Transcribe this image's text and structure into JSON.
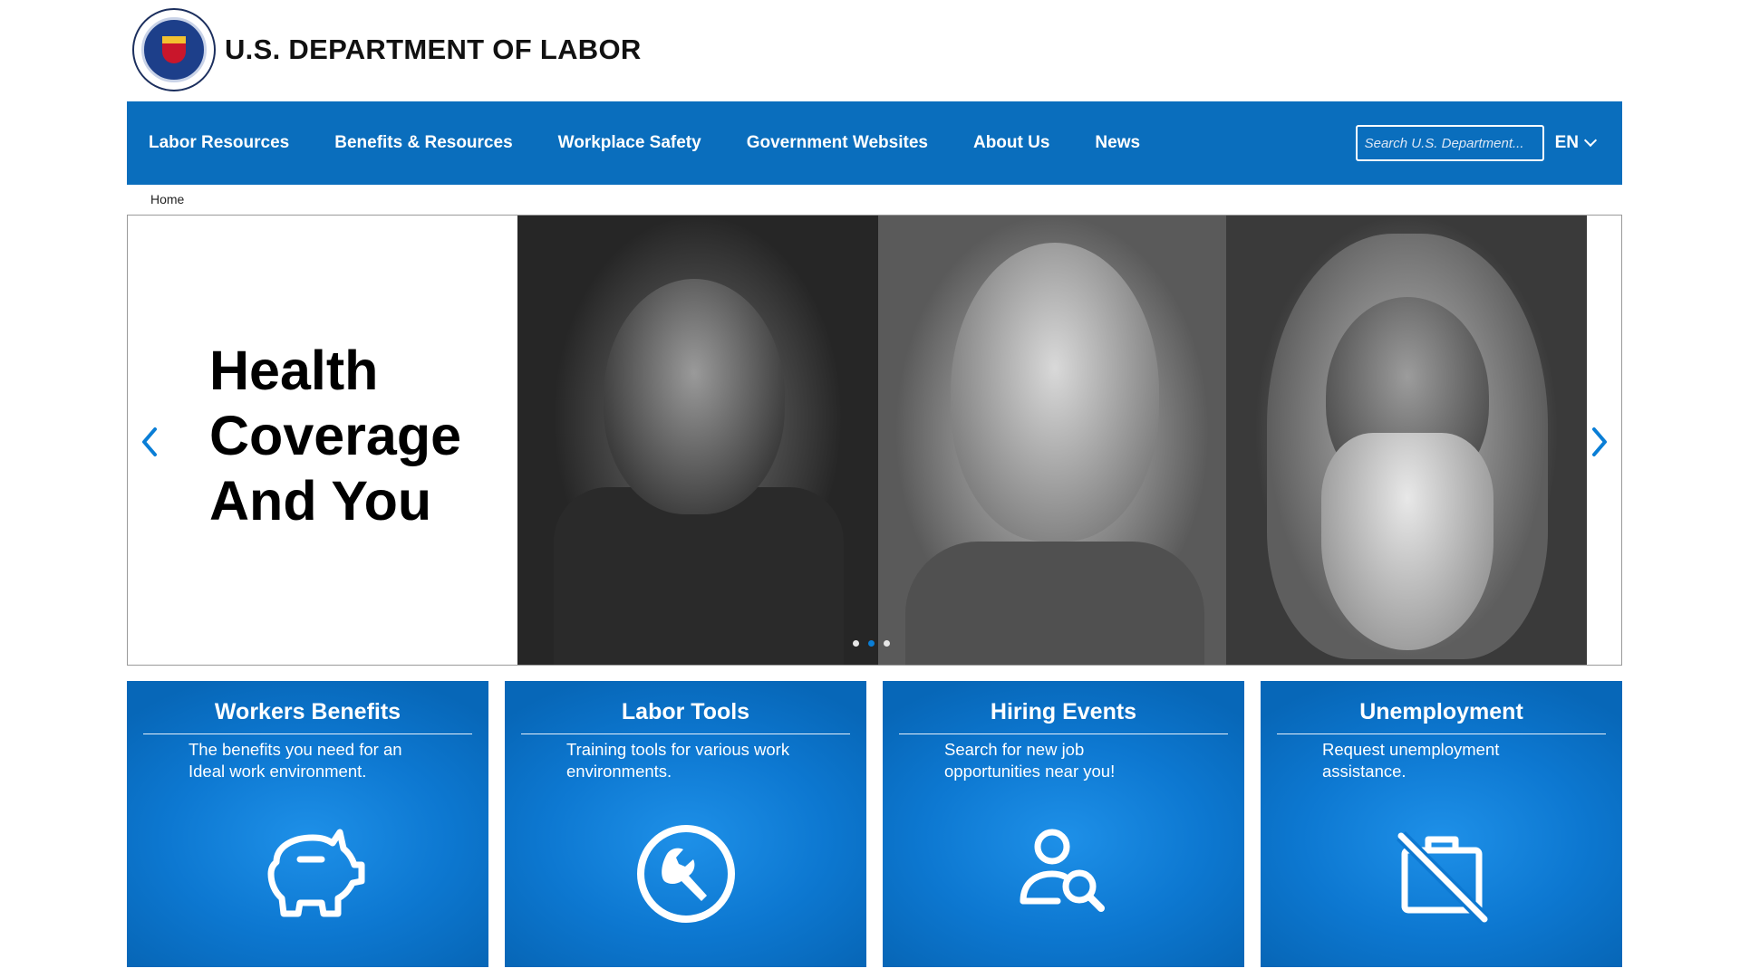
{
  "header": {
    "agency_name": "U.S. DEPARTMENT OF LABOR",
    "seal_icon": "dol-seal-icon"
  },
  "nav": {
    "items": [
      {
        "label": "Labor Resources"
      },
      {
        "label": "Benefits & Resources"
      },
      {
        "label": "Workplace Safety"
      },
      {
        "label": "Government Websites"
      },
      {
        "label": "About Us"
      },
      {
        "label": "News"
      }
    ],
    "search_placeholder": "Search U.S. Department...",
    "language": "EN"
  },
  "breadcrumb": {
    "home": "Home"
  },
  "hero": {
    "title": "Health Coverage And You",
    "slides_total": 3,
    "active_slide": 2
  },
  "cards": [
    {
      "title": "Workers Benefits",
      "description": "The benefits you need for an Ideal work environment.",
      "icon": "piggy-bank-icon"
    },
    {
      "title": "Labor Tools",
      "description": "Training tools for various work environments.",
      "icon": "wrench-icon"
    },
    {
      "title": "Hiring Events",
      "description": "Search for new job opportunities near you!",
      "icon": "person-search-icon"
    },
    {
      "title": "Unemployment",
      "description": "Request unemployment assistance.",
      "icon": "briefcase-off-icon"
    }
  ],
  "colors": {
    "brand_blue": "#0a6ebd",
    "card_blue": "#0d78d1",
    "active_dot": "#0a7ed6"
  }
}
